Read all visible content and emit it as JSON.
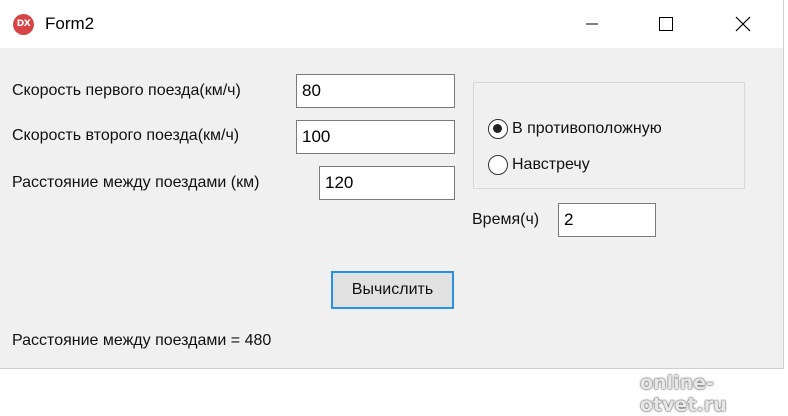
{
  "window": {
    "title": "Form2",
    "icon": "delphi-app-icon",
    "icon_text": "DX"
  },
  "form": {
    "speed1_label": "Скорость первого поезда(км/ч)",
    "speed1_value": "80",
    "speed2_label": "Скорость второго поезда(км/ч)",
    "speed2_value": "100",
    "distance_label": "Расстояние между поездами (км)",
    "distance_value": "120"
  },
  "direction": {
    "options": [
      {
        "label": "В противоположную",
        "selected": true
      },
      {
        "label": "Навстречу",
        "selected": false
      }
    ]
  },
  "time": {
    "label": "Время(ч)",
    "value": "2"
  },
  "compute_button": "Вычислить",
  "result_text": "Расстояние между поездами = 480",
  "watermark": "online-otvet.ru"
}
